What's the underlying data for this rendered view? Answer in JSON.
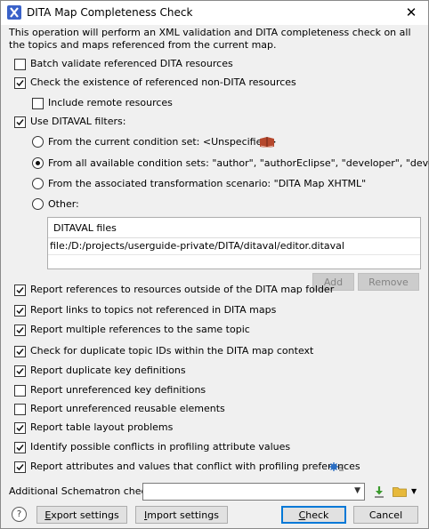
{
  "window": {
    "title": "DITA Map Completeness Check",
    "close_glyph": "✕",
    "icon": "oxygen-app-icon"
  },
  "description": "This operation will perform an XML validation and DITA completeness check on all the topics and maps referenced from the current map.",
  "options": {
    "batch_validate": {
      "label": "Batch validate referenced DITA resources",
      "checked": false
    },
    "check_existence": {
      "label": "Check the existence of referenced non-DITA resources",
      "checked": true
    },
    "include_remote": {
      "label": "Include remote resources",
      "checked": false
    },
    "use_ditaval": {
      "label": "Use DITAVAL filters:",
      "checked": true
    }
  },
  "ditaval_radios": [
    {
      "label": "From the current condition set: <Unspecified>",
      "selected": false
    },
    {
      "label": "From all available condition sets: \"author\", \"authorEclipse\", \"developer\", \"devel ...",
      "selected": true
    },
    {
      "label": "From the associated transformation scenario: \"DITA Map XHTML\"",
      "selected": false
    },
    {
      "label": "Other:",
      "selected": false
    }
  ],
  "ditaval_table": {
    "header": "DITAVAL files",
    "rows": [
      "file:/D:/projects/userguide-private/DITA/ditaval/editor.ditaval"
    ]
  },
  "table_buttons": {
    "add": "Add",
    "remove": "Remove"
  },
  "report_options": [
    {
      "label": "Report references to resources outside of the DITA map folder",
      "checked": true
    },
    {
      "label": "Report links to topics not referenced in DITA maps",
      "checked": true
    },
    {
      "label": "Report multiple references to the same topic",
      "checked": true
    },
    {
      "label": "Check for duplicate topic IDs within the DITA map context",
      "checked": true
    },
    {
      "label": "Report duplicate key definitions",
      "checked": true
    },
    {
      "label": "Report unreferenced key definitions",
      "checked": false
    },
    {
      "label": "Report unreferenced reusable elements",
      "checked": false
    },
    {
      "label": "Report table layout problems",
      "checked": true
    },
    {
      "label": "Identify possible conflicts in profiling attribute values",
      "checked": true
    },
    {
      "label": "Report attributes and values that conflict with profiling preferences",
      "checked": true
    }
  ],
  "schematron": {
    "label": "Additional Schematron checks:",
    "value": ""
  },
  "footer": {
    "export": "Export settings",
    "import": "Import settings",
    "check": "Check",
    "cancel": "Cancel",
    "help_glyph": "?"
  },
  "colors": {
    "accent": "#0078d7",
    "dialog_bg": "#f0f0f0",
    "book_icon": "#b5482d"
  }
}
